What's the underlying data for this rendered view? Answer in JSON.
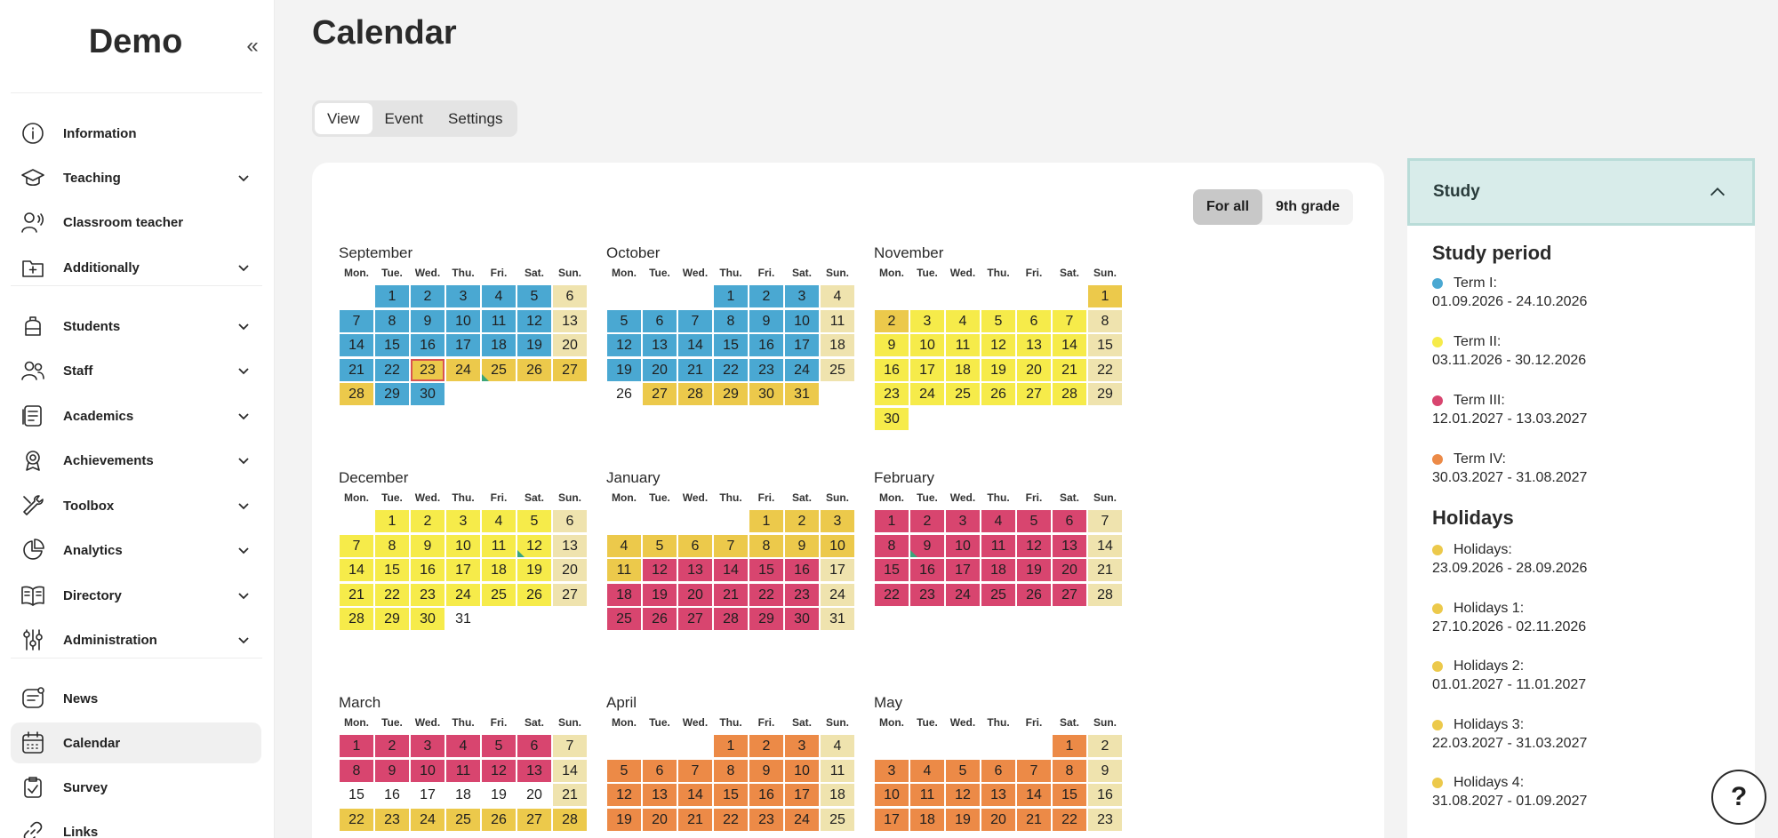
{
  "sidebar": {
    "brand": "Demo",
    "items": [
      {
        "label": "Information",
        "icon": "info-icon",
        "chevron": false
      },
      {
        "label": "Teaching",
        "icon": "graduation-cap-icon",
        "chevron": true
      },
      {
        "label": "Classroom teacher",
        "icon": "teacher-icon",
        "chevron": false
      },
      {
        "label": "Additionally",
        "icon": "folder-plus-icon",
        "chevron": true
      },
      {
        "label": "Students",
        "icon": "backpack-icon",
        "chevron": true
      },
      {
        "label": "Staff",
        "icon": "people-icon",
        "chevron": true
      },
      {
        "label": "Academics",
        "icon": "document-list-icon",
        "chevron": true
      },
      {
        "label": "Achievements",
        "icon": "award-icon",
        "chevron": true
      },
      {
        "label": "Toolbox",
        "icon": "tools-icon",
        "chevron": true
      },
      {
        "label": "Analytics",
        "icon": "pie-chart-icon",
        "chevron": true
      },
      {
        "label": "Directory",
        "icon": "book-icon",
        "chevron": true
      },
      {
        "label": "Administration",
        "icon": "sliders-icon",
        "chevron": true
      },
      {
        "label": "News",
        "icon": "news-icon",
        "chevron": false
      },
      {
        "label": "Calendar",
        "icon": "calendar-icon",
        "chevron": false,
        "active": true
      },
      {
        "label": "Survey",
        "icon": "clipboard-check-icon",
        "chevron": false
      },
      {
        "label": "Links",
        "icon": "link-icon",
        "chevron": false
      }
    ]
  },
  "header": {
    "title": "Calendar",
    "tabs": [
      {
        "label": "View",
        "active": true
      },
      {
        "label": "Event",
        "active": false
      },
      {
        "label": "Settings",
        "active": false
      }
    ]
  },
  "filter": {
    "options": [
      {
        "label": "For all",
        "active": true
      },
      {
        "label": "9th grade",
        "active": false
      }
    ]
  },
  "weekdays": [
    "Mon.",
    "Tue.",
    "Wed.",
    "Thu.",
    "Fri.",
    "Sat.",
    "Sun."
  ],
  "colors": {
    "term1": "#4aa8d2",
    "term2": "#f6eb4a",
    "term3": "#d8456f",
    "term4": "#ec8a47",
    "holiday": "#ecc94b",
    "weekend": "#efe3ae",
    "none": "#ffffff"
  },
  "months": [
    {
      "name": "September",
      "offset": 1,
      "days": [
        [
          1,
          "term1"
        ],
        [
          2,
          "term1"
        ],
        [
          3,
          "term1"
        ],
        [
          4,
          "term1"
        ],
        [
          5,
          "term1"
        ],
        [
          6,
          "weekend"
        ],
        [
          7,
          "term1"
        ],
        [
          8,
          "term1"
        ],
        [
          9,
          "term1"
        ],
        [
          10,
          "term1"
        ],
        [
          11,
          "term1"
        ],
        [
          12,
          "term1"
        ],
        [
          13,
          "weekend"
        ],
        [
          14,
          "term1"
        ],
        [
          15,
          "term1"
        ],
        [
          16,
          "term1"
        ],
        [
          17,
          "term1"
        ],
        [
          18,
          "term1"
        ],
        [
          19,
          "term1"
        ],
        [
          20,
          "weekend"
        ],
        [
          21,
          "term1"
        ],
        [
          22,
          "term1"
        ],
        [
          23,
          "holiday"
        ],
        [
          24,
          "holiday"
        ],
        [
          25,
          "holiday"
        ],
        [
          26,
          "holiday"
        ],
        [
          27,
          "holiday"
        ],
        [
          28,
          "holiday"
        ],
        [
          29,
          "term1"
        ],
        [
          30,
          "term1"
        ]
      ]
    },
    {
      "name": "October",
      "offset": 3,
      "days": [
        [
          1,
          "term1"
        ],
        [
          2,
          "term1"
        ],
        [
          3,
          "term1"
        ],
        [
          4,
          "weekend"
        ],
        [
          5,
          "term1"
        ],
        [
          6,
          "term1"
        ],
        [
          7,
          "term1"
        ],
        [
          8,
          "term1"
        ],
        [
          9,
          "term1"
        ],
        [
          10,
          "term1"
        ],
        [
          11,
          "weekend"
        ],
        [
          12,
          "term1"
        ],
        [
          13,
          "term1"
        ],
        [
          14,
          "term1"
        ],
        [
          15,
          "term1"
        ],
        [
          16,
          "term1"
        ],
        [
          17,
          "term1"
        ],
        [
          18,
          "weekend"
        ],
        [
          19,
          "term1"
        ],
        [
          20,
          "term1"
        ],
        [
          21,
          "term1"
        ],
        [
          22,
          "term1"
        ],
        [
          23,
          "term1"
        ],
        [
          24,
          "term1"
        ],
        [
          25,
          "weekend"
        ],
        [
          26,
          "none"
        ],
        [
          27,
          "holiday"
        ],
        [
          28,
          "holiday"
        ],
        [
          29,
          "holiday"
        ],
        [
          30,
          "holiday"
        ],
        [
          31,
          "holiday"
        ]
      ]
    },
    {
      "name": "November",
      "offset": 6,
      "days": [
        [
          1,
          "holiday"
        ],
        [
          2,
          "holiday"
        ],
        [
          3,
          "term2"
        ],
        [
          4,
          "term2"
        ],
        [
          5,
          "term2"
        ],
        [
          6,
          "term2"
        ],
        [
          7,
          "term2"
        ],
        [
          8,
          "weekend"
        ],
        [
          9,
          "term2"
        ],
        [
          10,
          "term2"
        ],
        [
          11,
          "term2"
        ],
        [
          12,
          "term2"
        ],
        [
          13,
          "term2"
        ],
        [
          14,
          "term2"
        ],
        [
          15,
          "weekend"
        ],
        [
          16,
          "term2"
        ],
        [
          17,
          "term2"
        ],
        [
          18,
          "term2"
        ],
        [
          19,
          "term2"
        ],
        [
          20,
          "term2"
        ],
        [
          21,
          "term2"
        ],
        [
          22,
          "weekend"
        ],
        [
          23,
          "term2"
        ],
        [
          24,
          "term2"
        ],
        [
          25,
          "term2"
        ],
        [
          26,
          "term2"
        ],
        [
          27,
          "term2"
        ],
        [
          28,
          "term2"
        ],
        [
          29,
          "weekend"
        ],
        [
          30,
          "term2"
        ]
      ]
    },
    {
      "name": "December",
      "offset": 1,
      "days": [
        [
          1,
          "term2"
        ],
        [
          2,
          "term2"
        ],
        [
          3,
          "term2"
        ],
        [
          4,
          "term2"
        ],
        [
          5,
          "term2"
        ],
        [
          6,
          "weekend"
        ],
        [
          7,
          "term2"
        ],
        [
          8,
          "term2"
        ],
        [
          9,
          "term2"
        ],
        [
          10,
          "term2"
        ],
        [
          11,
          "term2"
        ],
        [
          12,
          "term2"
        ],
        [
          13,
          "weekend"
        ],
        [
          14,
          "term2"
        ],
        [
          15,
          "term2"
        ],
        [
          16,
          "term2"
        ],
        [
          17,
          "term2"
        ],
        [
          18,
          "term2"
        ],
        [
          19,
          "term2"
        ],
        [
          20,
          "weekend"
        ],
        [
          21,
          "term2"
        ],
        [
          22,
          "term2"
        ],
        [
          23,
          "term2"
        ],
        [
          24,
          "term2"
        ],
        [
          25,
          "term2"
        ],
        [
          26,
          "term2"
        ],
        [
          27,
          "weekend"
        ],
        [
          28,
          "term2"
        ],
        [
          29,
          "term2"
        ],
        [
          30,
          "term2"
        ],
        [
          31,
          "none"
        ]
      ]
    },
    {
      "name": "January",
      "offset": 4,
      "days": [
        [
          1,
          "holiday"
        ],
        [
          2,
          "holiday"
        ],
        [
          3,
          "holiday"
        ],
        [
          4,
          "holiday"
        ],
        [
          5,
          "holiday"
        ],
        [
          6,
          "holiday"
        ],
        [
          7,
          "holiday"
        ],
        [
          8,
          "holiday"
        ],
        [
          9,
          "holiday"
        ],
        [
          10,
          "holiday"
        ],
        [
          11,
          "holiday"
        ],
        [
          12,
          "term3"
        ],
        [
          13,
          "term3"
        ],
        [
          14,
          "term3"
        ],
        [
          15,
          "term3"
        ],
        [
          16,
          "term3"
        ],
        [
          17,
          "weekend"
        ],
        [
          18,
          "term3"
        ],
        [
          19,
          "term3"
        ],
        [
          20,
          "term3"
        ],
        [
          21,
          "term3"
        ],
        [
          22,
          "term3"
        ],
        [
          23,
          "term3"
        ],
        [
          24,
          "weekend"
        ],
        [
          25,
          "term3"
        ],
        [
          26,
          "term3"
        ],
        [
          27,
          "term3"
        ],
        [
          28,
          "term3"
        ],
        [
          29,
          "term3"
        ],
        [
          30,
          "term3"
        ],
        [
          31,
          "weekend"
        ]
      ]
    },
    {
      "name": "February",
      "offset": 0,
      "days": [
        [
          1,
          "term3"
        ],
        [
          2,
          "term3"
        ],
        [
          3,
          "term3"
        ],
        [
          4,
          "term3"
        ],
        [
          5,
          "term3"
        ],
        [
          6,
          "term3"
        ],
        [
          7,
          "weekend"
        ],
        [
          8,
          "term3"
        ],
        [
          9,
          "term3"
        ],
        [
          10,
          "term3"
        ],
        [
          11,
          "term3"
        ],
        [
          12,
          "term3"
        ],
        [
          13,
          "term3"
        ],
        [
          14,
          "weekend"
        ],
        [
          15,
          "term3"
        ],
        [
          16,
          "term3"
        ],
        [
          17,
          "term3"
        ],
        [
          18,
          "term3"
        ],
        [
          19,
          "term3"
        ],
        [
          20,
          "term3"
        ],
        [
          21,
          "weekend"
        ],
        [
          22,
          "term3"
        ],
        [
          23,
          "term3"
        ],
        [
          24,
          "term3"
        ],
        [
          25,
          "term3"
        ],
        [
          26,
          "term3"
        ],
        [
          27,
          "term3"
        ],
        [
          28,
          "weekend"
        ]
      ]
    },
    {
      "name": "March",
      "offset": 0,
      "days": [
        [
          1,
          "term3"
        ],
        [
          2,
          "term3"
        ],
        [
          3,
          "term3"
        ],
        [
          4,
          "term3"
        ],
        [
          5,
          "term3"
        ],
        [
          6,
          "term3"
        ],
        [
          7,
          "weekend"
        ],
        [
          8,
          "term3"
        ],
        [
          9,
          "term3"
        ],
        [
          10,
          "term3"
        ],
        [
          11,
          "term3"
        ],
        [
          12,
          "term3"
        ],
        [
          13,
          "term3"
        ],
        [
          14,
          "weekend"
        ],
        [
          15,
          "none"
        ],
        [
          16,
          "none"
        ],
        [
          17,
          "none"
        ],
        [
          18,
          "none"
        ],
        [
          19,
          "none"
        ],
        [
          20,
          "none"
        ],
        [
          21,
          "weekend"
        ],
        [
          22,
          "holiday"
        ],
        [
          23,
          "holiday"
        ],
        [
          24,
          "holiday"
        ],
        [
          25,
          "holiday"
        ],
        [
          26,
          "holiday"
        ],
        [
          27,
          "holiday"
        ],
        [
          28,
          "holiday"
        ]
      ]
    },
    {
      "name": "April",
      "offset": 3,
      "days": [
        [
          1,
          "term4"
        ],
        [
          2,
          "term4"
        ],
        [
          3,
          "term4"
        ],
        [
          4,
          "weekend"
        ],
        [
          5,
          "term4"
        ],
        [
          6,
          "term4"
        ],
        [
          7,
          "term4"
        ],
        [
          8,
          "term4"
        ],
        [
          9,
          "term4"
        ],
        [
          10,
          "term4"
        ],
        [
          11,
          "weekend"
        ],
        [
          12,
          "term4"
        ],
        [
          13,
          "term4"
        ],
        [
          14,
          "term4"
        ],
        [
          15,
          "term4"
        ],
        [
          16,
          "term4"
        ],
        [
          17,
          "term4"
        ],
        [
          18,
          "weekend"
        ],
        [
          19,
          "term4"
        ],
        [
          20,
          "term4"
        ],
        [
          21,
          "term4"
        ],
        [
          22,
          "term4"
        ],
        [
          23,
          "term4"
        ],
        [
          24,
          "term4"
        ],
        [
          25,
          "weekend"
        ]
      ]
    },
    {
      "name": "May",
      "offset": 5,
      "days": [
        [
          1,
          "term4"
        ],
        [
          2,
          "weekend"
        ],
        [
          3,
          "term4"
        ],
        [
          4,
          "term4"
        ],
        [
          5,
          "term4"
        ],
        [
          6,
          "term4"
        ],
        [
          7,
          "term4"
        ],
        [
          8,
          "term4"
        ],
        [
          9,
          "weekend"
        ],
        [
          10,
          "term4"
        ],
        [
          11,
          "term4"
        ],
        [
          12,
          "term4"
        ],
        [
          13,
          "term4"
        ],
        [
          14,
          "term4"
        ],
        [
          15,
          "term4"
        ],
        [
          16,
          "weekend"
        ],
        [
          17,
          "term4"
        ],
        [
          18,
          "term4"
        ],
        [
          19,
          "term4"
        ],
        [
          20,
          "term4"
        ],
        [
          21,
          "term4"
        ],
        [
          22,
          "term4"
        ],
        [
          23,
          "weekend"
        ]
      ]
    }
  ],
  "panel": {
    "title": "Study",
    "study_title": "Study period",
    "study": [
      {
        "label": "Term I:",
        "range": "01.09.2026 - 24.10.2026",
        "color": "#4aa8d2"
      },
      {
        "label": "Term II:",
        "range": "03.11.2026 - 30.12.2026",
        "color": "#f6eb4a"
      },
      {
        "label": "Term III:",
        "range": "12.01.2027 - 13.03.2027",
        "color": "#d8456f"
      },
      {
        "label": "Term IV:",
        "range": "30.03.2027 - 31.08.2027",
        "color": "#ec8a47"
      }
    ],
    "holidays_title": "Holidays",
    "holidays": [
      {
        "label": "Holidays:",
        "range": "23.09.2026 - 28.09.2026",
        "color": "#ecc94b"
      },
      {
        "label": "Holidays 1:",
        "range": "27.10.2026 - 02.11.2026",
        "color": "#ecc94b"
      },
      {
        "label": "Holidays 2:",
        "range": "01.01.2027 - 11.01.2027",
        "color": "#ecc94b"
      },
      {
        "label": "Holidays 3:",
        "range": "22.03.2027 - 31.03.2027",
        "color": "#ecc94b"
      },
      {
        "label": "Holidays 4:",
        "range": "31.08.2027 - 01.09.2027",
        "color": "#ecc94b"
      }
    ]
  },
  "help": {
    "label": "?"
  }
}
